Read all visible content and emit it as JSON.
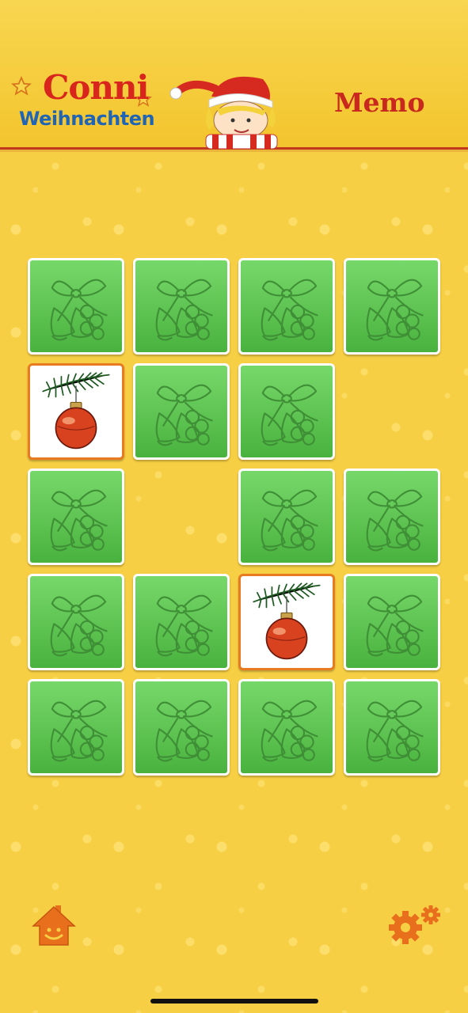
{
  "header": {
    "logo_line1": "Conni",
    "logo_line2": "Weihnachten",
    "title": "Memo",
    "mascot_icon": "conni-santa-hat-icon"
  },
  "colors": {
    "background": "#f7cf44",
    "card_back": "#5cc24f",
    "card_face_border": "#e87a22",
    "title_red": "#c8281d",
    "logo_blue": "#1f64b5",
    "icon_orange": "#e8701c"
  },
  "board": {
    "columns": 4,
    "rows": 5,
    "cards": [
      {
        "row": 0,
        "col": 0,
        "state": "hidden",
        "icon": "bells-bow-icon"
      },
      {
        "row": 0,
        "col": 1,
        "state": "hidden",
        "icon": "bells-bow-icon"
      },
      {
        "row": 0,
        "col": 2,
        "state": "hidden",
        "icon": "bells-bow-icon"
      },
      {
        "row": 0,
        "col": 3,
        "state": "hidden",
        "icon": "bells-bow-icon"
      },
      {
        "row": 1,
        "col": 0,
        "state": "revealed",
        "icon": "christmas-ornament-icon"
      },
      {
        "row": 1,
        "col": 1,
        "state": "hidden",
        "icon": "bells-bow-icon"
      },
      {
        "row": 1,
        "col": 2,
        "state": "hidden",
        "icon": "bells-bow-icon"
      },
      {
        "row": 2,
        "col": 0,
        "state": "hidden",
        "icon": "bells-bow-icon"
      },
      {
        "row": 2,
        "col": 2,
        "state": "hidden",
        "icon": "bells-bow-icon"
      },
      {
        "row": 2,
        "col": 3,
        "state": "hidden",
        "icon": "bells-bow-icon"
      },
      {
        "row": 3,
        "col": 0,
        "state": "hidden",
        "icon": "bells-bow-icon"
      },
      {
        "row": 3,
        "col": 1,
        "state": "hidden",
        "icon": "bells-bow-icon"
      },
      {
        "row": 3,
        "col": 2,
        "state": "revealed",
        "icon": "christmas-ornament-icon"
      },
      {
        "row": 3,
        "col": 3,
        "state": "hidden",
        "icon": "bells-bow-icon"
      },
      {
        "row": 4,
        "col": 0,
        "state": "hidden",
        "icon": "bells-bow-icon"
      },
      {
        "row": 4,
        "col": 1,
        "state": "hidden",
        "icon": "bells-bow-icon"
      },
      {
        "row": 4,
        "col": 2,
        "state": "hidden",
        "icon": "bells-bow-icon"
      },
      {
        "row": 4,
        "col": 3,
        "state": "hidden",
        "icon": "bells-bow-icon"
      }
    ]
  },
  "footer": {
    "home_icon": "home-icon",
    "settings_icon": "gear-icon"
  }
}
